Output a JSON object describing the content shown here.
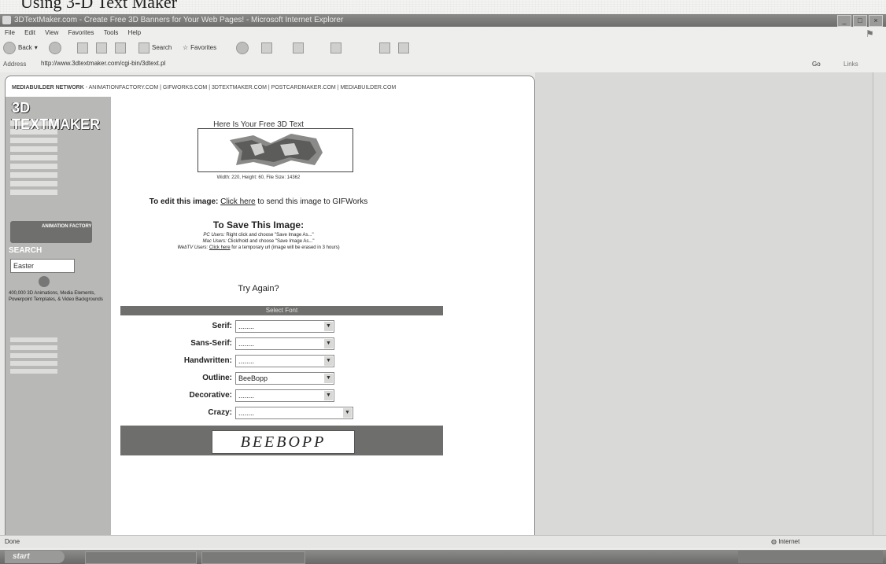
{
  "doc_title": "Using 3-D Text Maker",
  "window": {
    "title": "3DTextMaker.com - Create Free 3D Banners for Your Web Pages! - Microsoft Internet Explorer",
    "buttons": {
      "minimize": "_",
      "maximize": "□",
      "close": "×"
    }
  },
  "menu": [
    "File",
    "Edit",
    "View",
    "Favorites",
    "Tools",
    "Help"
  ],
  "toolbar": {
    "back": "Back",
    "search": "Search",
    "favorites": "Favorites"
  },
  "address": {
    "label": "Address",
    "url": "http://www.3dtextmaker.com/cgi-bin/3dtext.pl",
    "go": "Go",
    "links": "Links"
  },
  "page": {
    "network_label": "MEDIABUILDER NETWORK",
    "network_links": " - ANIMATIONFACTORY.COM | GIFWORKS.COM | 3DTEXTMAKER.COM | POSTCARDMAKER.COM | MEDIABUILDER.COM",
    "logo": "3D TEXTMAKER",
    "sidebar": {
      "badge": "ANIMATION FACTORY",
      "search_title": "SEARCH",
      "search_value": "Easter",
      "promo": "400,000 3D Animations, Media Elements, Powerpoint Templates, & Video Backgrounds"
    },
    "result": {
      "title": "Here Is Your Free 3D Text",
      "dims": "Width: 220, Height: 60, File Size: 14362",
      "edit_prefix": "To edit this image:",
      "edit_link": "Click here",
      "edit_suffix": " to send this image to GIFWorks",
      "save_title": "To Save This Image:",
      "save_pc_label": "PC Users:",
      "save_pc": " Right click and choose \"Save Image As...\"",
      "save_mac_label": "Mac Users:",
      "save_mac": " Click/hold and choose \"Save Image As...\"",
      "save_webtv_label": "WebTV Users:",
      "save_webtv_link": "Click here",
      "save_webtv": " for a temporary url (image will be erased in 3 hours)",
      "try_again": "Try Again?",
      "font_header": "Select Font"
    },
    "fonts": [
      {
        "label": "Serif:",
        "value": "........"
      },
      {
        "label": "Sans-Serif:",
        "value": "........"
      },
      {
        "label": "Handwritten:",
        "value": "........"
      },
      {
        "label": "Outline:",
        "value": "BeeBopp"
      },
      {
        "label": "Decorative:",
        "value": "........"
      },
      {
        "label": "Crazy:",
        "value": "........"
      }
    ],
    "banner_text": "BEEBOPP"
  },
  "status": {
    "left": "Done",
    "zone": "Internet"
  },
  "taskbar": {
    "start": "start"
  }
}
